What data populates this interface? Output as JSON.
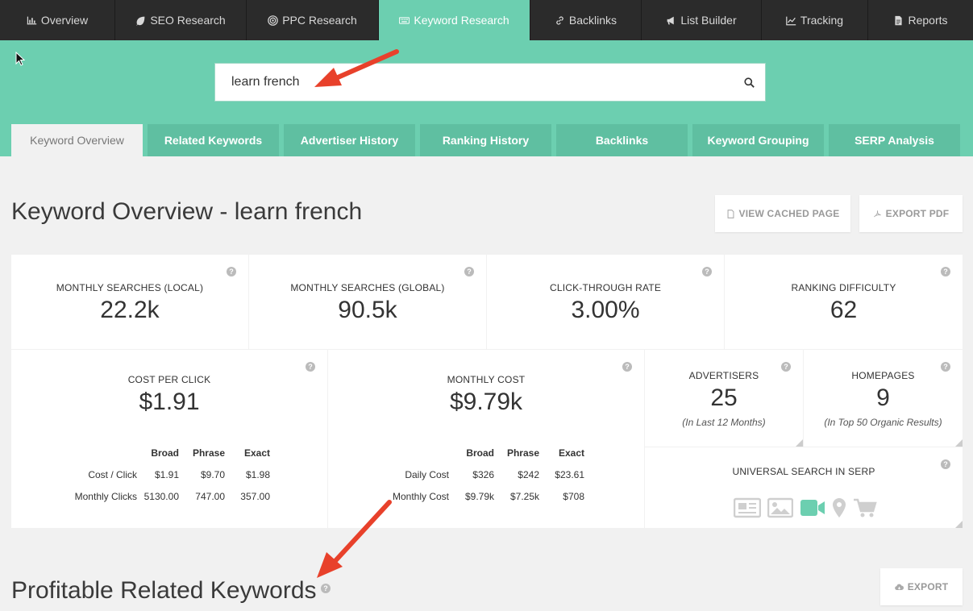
{
  "nav": {
    "items": [
      {
        "label": "Overview",
        "icon": "bar-chart-icon"
      },
      {
        "label": "SEO Research",
        "icon": "leaf-icon"
      },
      {
        "label": "PPC Research",
        "icon": "target-icon"
      },
      {
        "label": "Keyword Research",
        "icon": "keyboard-icon"
      },
      {
        "label": "Backlinks",
        "icon": "link-icon"
      },
      {
        "label": "List Builder",
        "icon": "megaphone-icon"
      },
      {
        "label": "Tracking",
        "icon": "line-chart-icon"
      },
      {
        "label": "Reports",
        "icon": "document-icon"
      }
    ],
    "active": "Keyword Research"
  },
  "search": {
    "value": "learn french"
  },
  "subtabs": [
    "Keyword Overview",
    "Related Keywords",
    "Advertiser History",
    "Ranking History",
    "Backlinks",
    "Keyword Grouping",
    "SERP Analysis"
  ],
  "header": {
    "title": "Keyword Overview - learn french",
    "view_cached_label": "VIEW CACHED PAGE",
    "export_pdf_label": "EXPORT PDF"
  },
  "stats": {
    "monthly_local": {
      "label": "MONTHLY SEARCHES (LOCAL)",
      "value": "22.2k"
    },
    "monthly_global": {
      "label": "MONTHLY SEARCHES (GLOBAL)",
      "value": "90.5k"
    },
    "ctr": {
      "label": "CLICK-THROUGH RATE",
      "value": "3.00%"
    },
    "difficulty": {
      "label": "RANKING DIFFICULTY",
      "value": "62"
    },
    "cpc": {
      "label": "COST PER CLICK",
      "value": "$1.91",
      "columns": [
        "Broad",
        "Phrase",
        "Exact"
      ],
      "rows": [
        {
          "label": "Cost / Click",
          "values": [
            "$1.91",
            "$9.70",
            "$1.98"
          ]
        },
        {
          "label": "Monthly Clicks",
          "values": [
            "5130.00",
            "747.00",
            "357.00"
          ]
        }
      ]
    },
    "monthly_cost": {
      "label": "MONTHLY COST",
      "value": "$9.79k",
      "columns": [
        "Broad",
        "Phrase",
        "Exact"
      ],
      "rows": [
        {
          "label": "Daily Cost",
          "values": [
            "$326",
            "$242",
            "$23.61"
          ]
        },
        {
          "label": "Monthly Cost",
          "values": [
            "$9.79k",
            "$7.25k",
            "$708"
          ]
        }
      ]
    },
    "advertisers": {
      "label": "ADVERTISERS",
      "value": "25",
      "note": "(In Last 12 Months)"
    },
    "homepages": {
      "label": "HOMEPAGES",
      "value": "9",
      "note": "(In Top 50 Organic Results)"
    },
    "universal": {
      "label": "UNIVERSAL SEARCH IN SERP",
      "icons": [
        "news-icon",
        "image-icon",
        "video-icon",
        "map-pin-icon",
        "shopping-cart-icon"
      ],
      "active_icon": "video-icon"
    }
  },
  "section": {
    "title": "Profitable Related Keywords",
    "export_label": "EXPORT"
  },
  "colors": {
    "accent": "#6ccfb0",
    "accent_dark": "#5fbfa1",
    "nav_bg": "#2b2b2b",
    "arrow": "#e8412b"
  }
}
